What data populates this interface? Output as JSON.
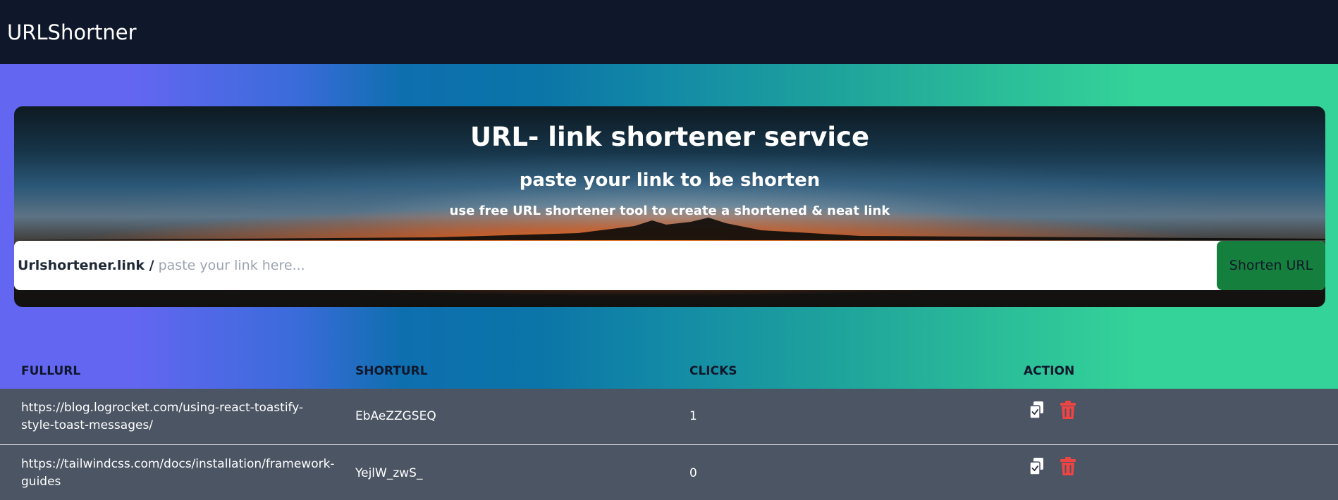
{
  "navbar": {
    "brand": "URLShortner"
  },
  "hero": {
    "title": "URL- link shortener service",
    "subtitle": "paste your link to be shorten",
    "description": "use free URL shortener tool to create a shortened & neat link",
    "domain_prefix": "Urlshortener.link /",
    "input_placeholder": "paste your link here...",
    "input_value": "",
    "button_label": "Shorten URL"
  },
  "table": {
    "headers": [
      "FULLURL",
      "SHORTURL",
      "CLICKS",
      "ACTION"
    ],
    "rows": [
      {
        "full_url": "https://blog.logrocket.com/using-react-toastify-style-toast-messages/",
        "short_url": "EbAeZZGSEQ",
        "clicks": "1"
      },
      {
        "full_url": "https://tailwindcss.com/docs/installation/framework-guides",
        "short_url": "YejlW_zwS_",
        "clicks": "0"
      }
    ],
    "action_icons": [
      "copy-icon",
      "trash-icon"
    ]
  },
  "colors": {
    "navbar_bg": "#0f172a",
    "gradient_start": "#6366f1",
    "gradient_end": "#34d399",
    "button_bg": "#15803d",
    "row_bg": "#4b5563",
    "trash_color": "#ef4444"
  }
}
